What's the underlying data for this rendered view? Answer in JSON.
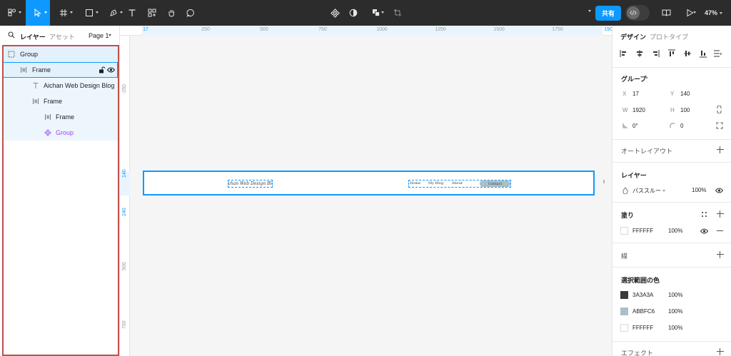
{
  "toolbar": {
    "share_label": "共有",
    "zoom": "47%"
  },
  "left_panel": {
    "tab_layers": "レイヤー",
    "tab_assets": "アセット",
    "page": "Page 1",
    "layers": [
      {
        "name": "Group"
      },
      {
        "name": "Frame"
      },
      {
        "name": "Aichan Web Design Blog"
      },
      {
        "name": "Frame"
      },
      {
        "name": "Frame"
      },
      {
        "name": "Group"
      }
    ]
  },
  "rulers": {
    "top": [
      "17",
      "250",
      "500",
      "750",
      "1000",
      "1250",
      "1500",
      "1750",
      "190"
    ],
    "left": [
      "-250",
      "140",
      "240",
      "500",
      "750"
    ]
  },
  "canvas": {
    "blog_title": "Aichan Web Design Blog",
    "nav": [
      "Home",
      "My Blog",
      "About"
    ],
    "contact": "Contact"
  },
  "right_panel": {
    "tab_design": "デザイン",
    "tab_prototype": "プロトタイプ",
    "group": {
      "title": "グループ",
      "x_label": "X",
      "x": "17",
      "y_label": "Y",
      "y": "140",
      "w_label": "W",
      "w": "1920",
      "h_label": "H",
      "h": "100",
      "rotation": "0°",
      "radius": "0"
    },
    "auto_layout": "オートレイアウト",
    "layer": {
      "title": "レイヤー",
      "blend": "パススルー",
      "opacity": "100%"
    },
    "fill": {
      "title": "塗り",
      "hex": "FFFFFF",
      "opacity": "100%"
    },
    "stroke": {
      "title": "線"
    },
    "selection_colors": {
      "title": "選択範囲の色",
      "items": [
        {
          "hex": "3A3A3A",
          "opacity": "100%"
        },
        {
          "hex": "ABBFC6",
          "opacity": "100%"
        },
        {
          "hex": "FFFFFF",
          "opacity": "100%"
        }
      ]
    },
    "effects": "エフェクト"
  },
  "colors": {
    "accent": "#0d99ff",
    "toolbar_bg": "#2c2c2c",
    "annotation_red": "#c0504d"
  }
}
